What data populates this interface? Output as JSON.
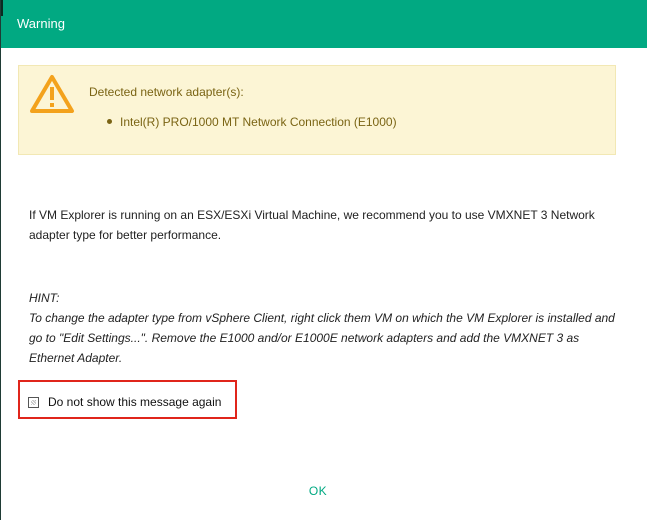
{
  "dialog": {
    "title": "Warning"
  },
  "alert": {
    "icon": "warning-triangle-icon",
    "icon_color": "#f3a21c",
    "heading": "Detected network adapter(s):",
    "adapters": [
      "Intel(R) PRO/1000 MT Network Connection (E1000)"
    ]
  },
  "message": {
    "body": "If VM Explorer is running on an ESX/ESXi Virtual Machine, we recommend you to use VMXNET 3 Network adapter type for better performance.",
    "hint_title": "HINT:",
    "hint_body": "To change the adapter type from vSphere Client, right click them VM on which the VM Explorer is installed and go to \"Edit Settings...\". Remove the E1000 and/or E1000E network adapters and add the VMXNET 3 as Ethernet Adapter."
  },
  "options": {
    "dont_show_label": "Do not show this message again",
    "dont_show_checked": false
  },
  "actions": {
    "ok_label": "OK"
  },
  "colors": {
    "accent": "#01a982",
    "alert_bg": "#fcf5d5",
    "alert_text": "#7a6414",
    "highlight_border": "#e0251b"
  }
}
